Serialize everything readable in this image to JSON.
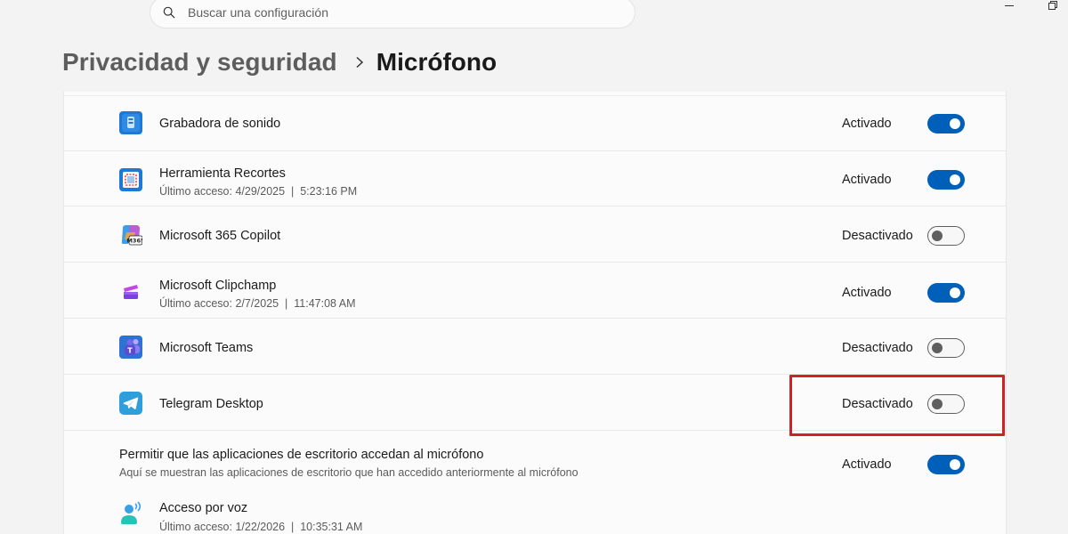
{
  "search": {
    "placeholder": "Buscar una configuración"
  },
  "breadcrumb": {
    "parent": "Privacidad y seguridad",
    "current": "Micrófono"
  },
  "apps": [
    {
      "name": "Grabadora de sonido",
      "last_access": "",
      "state": "Activado",
      "on": true,
      "icon": "voice-recorder-icon"
    },
    {
      "name": "Herramienta Recortes",
      "last_access": "Último acceso: 4/29/2025  |  5:23:16 PM",
      "state": "Activado",
      "on": true,
      "icon": "snipping-tool-icon"
    },
    {
      "name": "Microsoft 365 Copilot",
      "last_access": "",
      "state": "Desactivado",
      "on": false,
      "icon": "m365-copilot-icon"
    },
    {
      "name": "Microsoft Clipchamp",
      "last_access": "Último acceso: 2/7/2025  |  11:47:08 AM",
      "state": "Activado",
      "on": true,
      "icon": "clipchamp-icon"
    },
    {
      "name": "Microsoft Teams",
      "last_access": "",
      "state": "Desactivado",
      "on": false,
      "icon": "teams-icon"
    },
    {
      "name": "Telegram Desktop",
      "last_access": "",
      "state": "Desactivado",
      "on": false,
      "icon": "telegram-icon"
    }
  ],
  "desktop_apps": {
    "title": "Permitir que las aplicaciones de escritorio accedan al micrófono",
    "subtitle": "Aquí se muestran las aplicaciones de escritorio que han accedido anteriormente al micrófono",
    "state": "Activado",
    "on": true,
    "items": [
      {
        "name": "Acceso por voz",
        "last_access": "Último acceso: 1/22/2026  |  10:35:31 AM",
        "icon": "voice-access-icon"
      }
    ]
  },
  "colors": {
    "accent": "#005fb8",
    "highlight": "#d32027"
  }
}
